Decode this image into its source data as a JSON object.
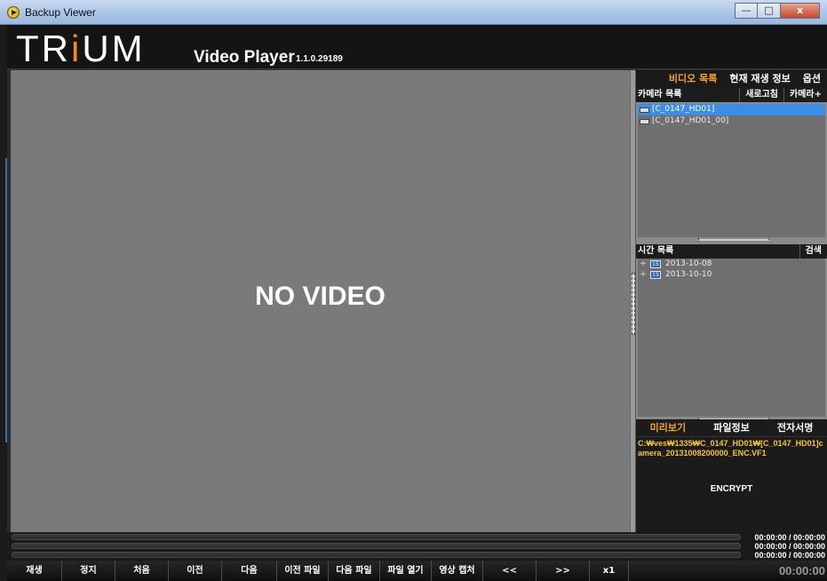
{
  "window": {
    "title": "Backup Viewer",
    "minimize": "—",
    "maximize": "□",
    "close": "x"
  },
  "header": {
    "logo_part1": "TR",
    "logo_accent": "i",
    "logo_part2": "UM",
    "product": "Video Player",
    "version": "1.1.0.29189"
  },
  "video": {
    "status": "NO VIDEO"
  },
  "right_panel": {
    "tabs": [
      {
        "label": "비디오 목록",
        "active": true
      },
      {
        "label": "현재 재생 정보",
        "active": false
      },
      {
        "label": "옵션",
        "active": false
      }
    ],
    "camera_list": {
      "label": "카메라 목록",
      "refresh": "새로고침",
      "add": "카메라+",
      "items": [
        {
          "label": "[C_0147_HD01]",
          "selected": true
        },
        {
          "label": "[C_0147_HD01_00]",
          "selected": false
        }
      ]
    },
    "time_list": {
      "label": "시간 목록",
      "search": "검색",
      "items": [
        {
          "expander": "+",
          "icon_text": "15",
          "label": "2013-10-08"
        },
        {
          "expander": "+",
          "icon_text": "15",
          "label": "2013-10-10"
        }
      ]
    },
    "preview": {
      "tabs": [
        {
          "label": "미리보기",
          "active": true
        },
        {
          "label": "파일정보",
          "active": false
        },
        {
          "label": "전자서명",
          "active": false
        }
      ],
      "path": "C:₩ves₩1335₩C_0147_HD01₩[C_0147_HD01]camera_20131008200000_ENC.VF1",
      "status": "ENCRYPT"
    }
  },
  "progress": {
    "times": [
      "00:00:00 / 00:00:00",
      "00:00:00 / 00:00:00",
      "00:00:00 / 00:00:00"
    ]
  },
  "controls": {
    "buttons": [
      "재생",
      "정지",
      "처음",
      "이전",
      "다음",
      "이전 파일",
      "다음 파일",
      "파일 열기",
      "영상 캡처",
      "<<",
      ">>",
      "x1"
    ],
    "time": "00:00:00"
  },
  "colors": {
    "accent": "#f5a623",
    "selection": "#3a8ee8",
    "path_text": "#f5c623"
  }
}
